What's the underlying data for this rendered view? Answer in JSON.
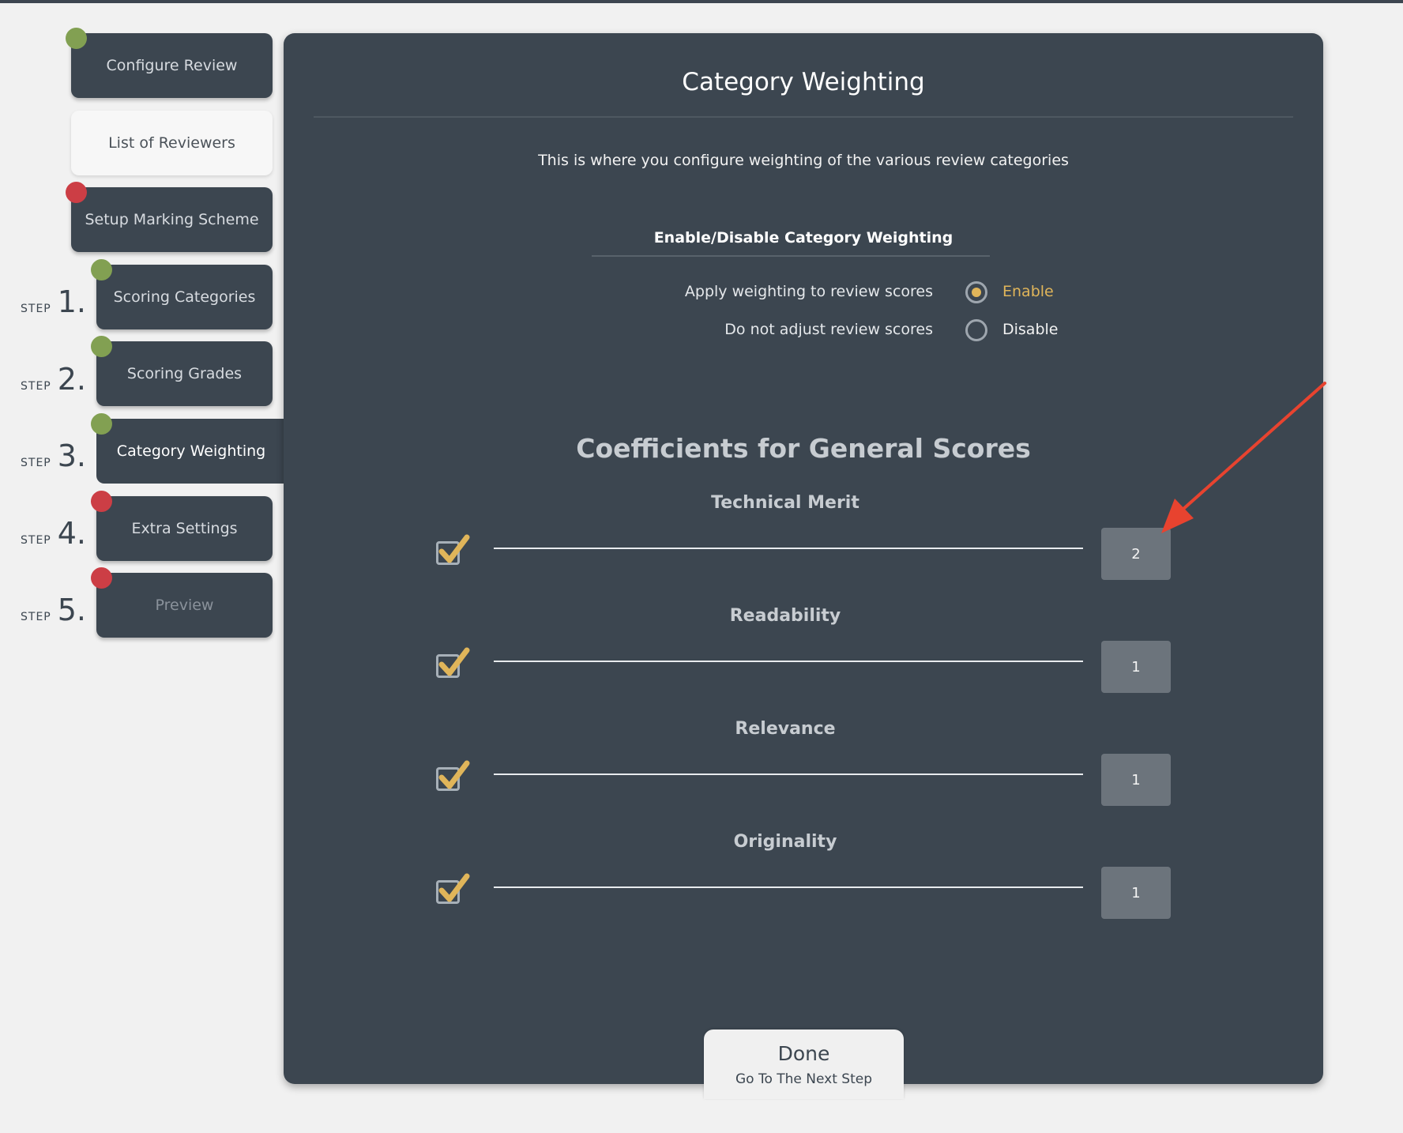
{
  "nav": {
    "configure_review": "Configure Review",
    "list_of_reviewers": "List of Reviewers",
    "setup_marking_scheme": "Setup Marking Scheme",
    "scoring_categories": "Scoring Categories",
    "scoring_grades": "Scoring Grades",
    "category_weighting": "Category Weighting",
    "extra_settings": "Extra Settings",
    "preview": "Preview"
  },
  "steps": {
    "word": "STEP",
    "s1": "1.",
    "s2": "2.",
    "s3": "3.",
    "s4": "4.",
    "s5": "5."
  },
  "main": {
    "title": "Category Weighting",
    "intro": "This is where you configure weighting of the various review categories",
    "weighting_heading": "Enable/Disable Category Weighting",
    "option_apply": "Apply weighting to review scores",
    "option_enable": "Enable",
    "option_no_adjust": "Do not adjust review scores",
    "option_disable": "Disable",
    "coefficients_heading": "Coefficients for General Scores",
    "categories": [
      {
        "name": "Technical Merit",
        "value": "2"
      },
      {
        "name": "Readability",
        "value": "1"
      },
      {
        "name": "Relevance",
        "value": "1"
      },
      {
        "name": "Originality",
        "value": "1"
      }
    ]
  },
  "done": {
    "label": "Done",
    "sub": "Go To The Next Step"
  },
  "colors": {
    "panel": "#3c4650",
    "accent": "#e0b55a",
    "status_ok": "#82a052",
    "status_error": "#cc3e45"
  }
}
